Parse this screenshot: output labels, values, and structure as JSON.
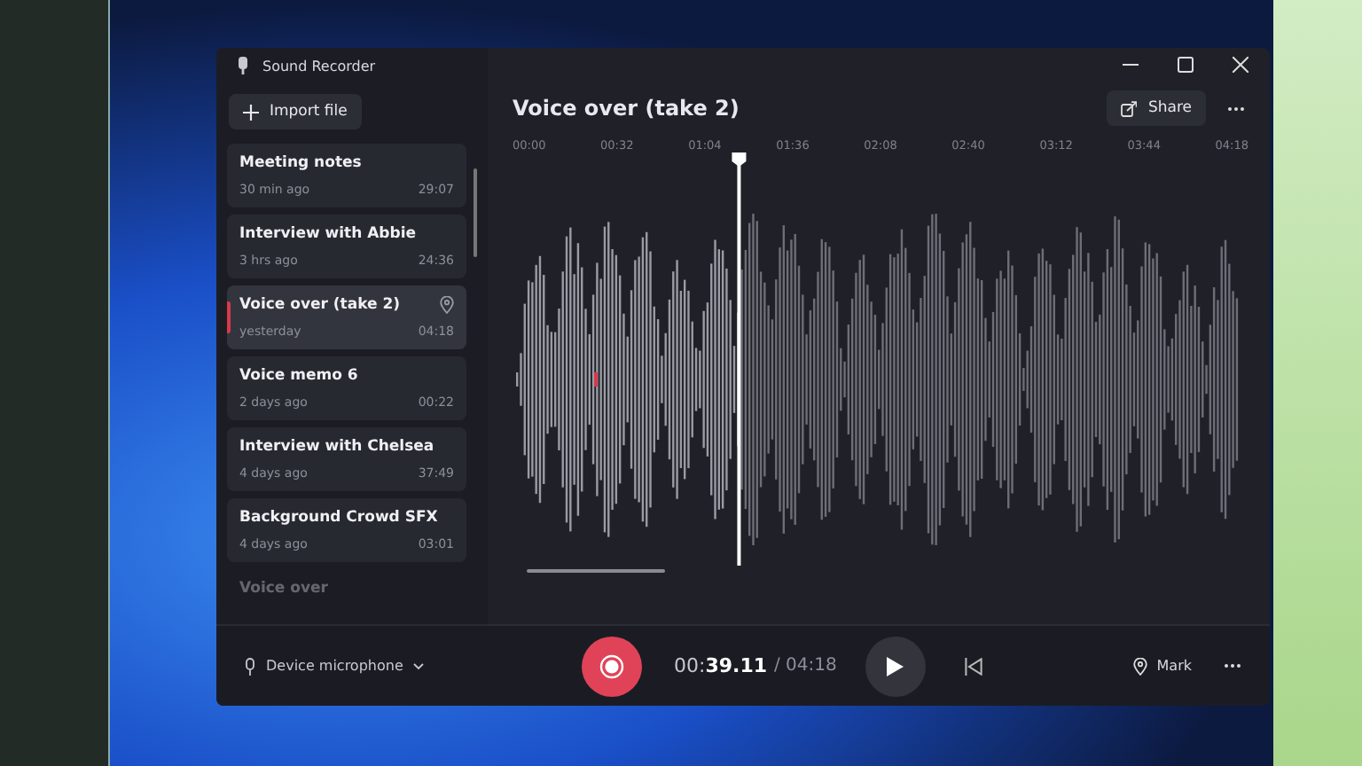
{
  "window": {
    "title": "Sound Recorder"
  },
  "import_button": {
    "label": "Import file"
  },
  "recordings": [
    {
      "name": "Meeting notes",
      "age": "30 min ago",
      "duration": "29:07",
      "selected": false,
      "marked": false,
      "faded": false
    },
    {
      "name": "Interview with Abbie",
      "age": "3 hrs ago",
      "duration": "24:36",
      "selected": false,
      "marked": false,
      "faded": false
    },
    {
      "name": "Voice over (take 2)",
      "age": "yesterday",
      "duration": "04:18",
      "selected": true,
      "marked": true,
      "faded": false
    },
    {
      "name": "Voice memo 6",
      "age": "2 days ago",
      "duration": "00:22",
      "selected": false,
      "marked": false,
      "faded": false
    },
    {
      "name": "Interview with Chelsea",
      "age": "4 days ago",
      "duration": "37:49",
      "selected": false,
      "marked": false,
      "faded": false
    },
    {
      "name": "Background Crowd SFX",
      "age": "4 days ago",
      "duration": "03:01",
      "selected": false,
      "marked": false,
      "faded": false
    },
    {
      "name": "Voice over",
      "faded": true,
      "selected": false,
      "marked": false
    }
  ],
  "recording": {
    "title": "Voice over (take 2)",
    "share": "Share"
  },
  "timeline": {
    "ticks": [
      "00:00",
      "00:32",
      "01:04",
      "01:36",
      "02:08",
      "02:40",
      "03:12",
      "03:44",
      "04:18"
    ],
    "playhead": {
      "level": 0.31
    }
  },
  "footer": {
    "input_device": "Device microphone",
    "elapsed": "00:**39.11**",
    "total": "/ 04:18",
    "mark": "Mark"
  }
}
